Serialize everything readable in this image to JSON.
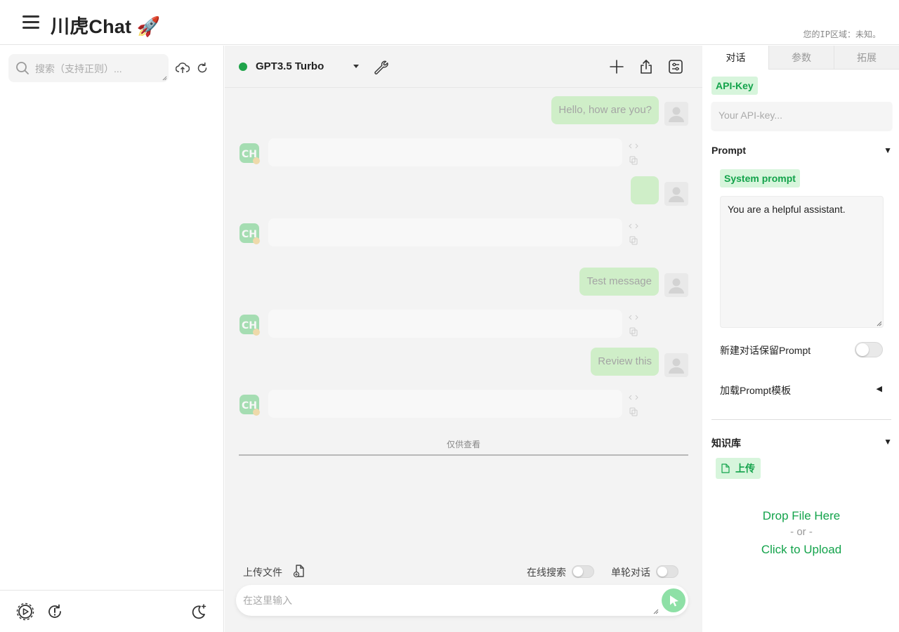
{
  "header": {
    "title": "川虎Chat 🚀",
    "ip_notice": "您的IP区域：未知。"
  },
  "sidebar": {
    "search_placeholder": "搜索（支持正则）...",
    "icons": [
      "upload-history-icon",
      "refresh-icon"
    ],
    "footer_icons": [
      "settings-icon",
      "update-icon",
      "dark-mode-icon"
    ]
  },
  "toolbar": {
    "model_name": "GPT3.5 Turbo",
    "status_color": "#1fa34a"
  },
  "messages": [
    {
      "role": "user",
      "text": "Hello, how are you?"
    },
    {
      "role": "assistant",
      "text": ""
    },
    {
      "role": "user",
      "text": ""
    },
    {
      "role": "assistant",
      "text": ""
    },
    {
      "role": "user",
      "text": "Test message"
    },
    {
      "role": "assistant",
      "text": ""
    },
    {
      "role": "user",
      "text": "Review this"
    },
    {
      "role": "assistant",
      "text": ""
    }
  ],
  "divider_label": "仅供查看",
  "input": {
    "upload_label": "上传文件",
    "online_search_label": "在线搜索",
    "online_search_on": false,
    "single_turn_label": "单轮对话",
    "single_turn_on": false,
    "placeholder": "在这里输入"
  },
  "right_panel": {
    "tabs": [
      "对话",
      "参数",
      "拓展"
    ],
    "active_tab": "对话",
    "api_key_label": "API-Key",
    "api_key_placeholder": "Your API-key...",
    "prompt_section": "Prompt",
    "system_prompt_label": "System prompt",
    "system_prompt_value": "You are a helpful assistant.",
    "keep_prompt_label": "新建对话保留Prompt",
    "keep_prompt_on": false,
    "load_template_label": "加载Prompt模板",
    "knowledge_section": "知识库",
    "upload_button": "上传",
    "drop_line1": "Drop File Here",
    "drop_line2": "- or -",
    "drop_line3": "Click to Upload"
  },
  "colors": {
    "accent": "#13a34b",
    "chip_bg": "#d7f5dc",
    "user_bubble": "#9ee88e"
  }
}
